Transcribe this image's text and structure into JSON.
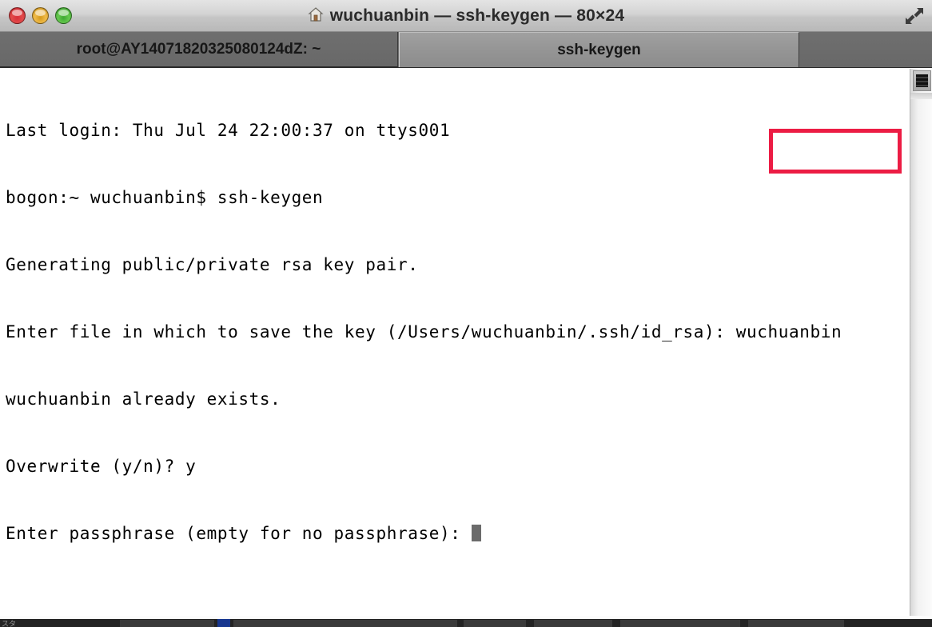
{
  "window": {
    "title": "wuchuanbin — ssh-keygen — 80×24",
    "home_icon": "home-icon",
    "fullscreen_icon": "fullscreen-arrows-icon",
    "controls": {
      "close_label": "close",
      "minimize_label": "minimize",
      "zoom_label": "zoom"
    }
  },
  "tabs": [
    {
      "label": "root@AY14071820325080124dZ: ~",
      "active": false
    },
    {
      "label": "ssh-keygen",
      "active": true
    }
  ],
  "terminal": {
    "lines": [
      "Last login: Thu Jul 24 22:00:37 on ttys001",
      "bogon:~ wuchuanbin$ ssh-keygen",
      "Generating public/private rsa key pair.",
      "Enter file in which to save the key (/Users/wuchuanbin/.ssh/id_rsa): wuchuanbin",
      "wuchuanbin already exists.",
      "Overwrite (y/n)? y",
      "Enter passphrase (empty for no passphrase): "
    ],
    "cursor": "block",
    "text_color": "#000000",
    "background_color": "#ffffff"
  },
  "annotation": {
    "type": "rectangle-highlight",
    "color": "#ec1c44",
    "target_text": "wuchuanbin"
  },
  "scrollbar": {
    "orientation": "vertical",
    "thumb_position": "top"
  },
  "taskbar": {
    "label": "スタ"
  }
}
